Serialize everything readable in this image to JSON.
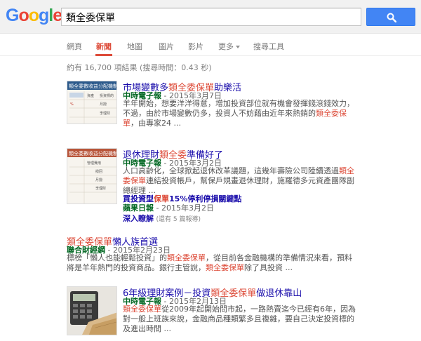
{
  "header": {
    "logo": "Google",
    "search_value": "類全委保單",
    "colors": {
      "search_button": "#4285f4",
      "accent": "#dd4b39",
      "link": "#1a0dab",
      "source": "#006621"
    }
  },
  "tabs": [
    {
      "label": "網頁"
    },
    {
      "label": "新聞"
    },
    {
      "label": "地圖"
    },
    {
      "label": "圖片"
    },
    {
      "label": "影片"
    },
    {
      "label": "更多"
    },
    {
      "label": "搜尋工具"
    }
  ],
  "stats": "約有 16,700 項結果 (搜尋時間：0.43 秒)",
  "results": [
    {
      "title_pre": "市場變數多",
      "title_hl": "類全委保單",
      "title_post": "助樂活",
      "source": "中時電子報",
      "date": " - 2015年3月7日",
      "snippet_a": "羊年開始，想要洋洋得意，增加投資部位就有機會發揮錢滾錢效力，不過，由於市場變數仍多，投資人不妨藉由近年來熱銷的",
      "snippet_hl": "類全委保單",
      "snippet_b": "，由專家24 ...",
      "thumb_title": "類全委數收益分配機制",
      "thumb_rows": [
        "資產",
        "投資標的",
        "月撥",
        "李理財"
      ]
    },
    {
      "title_pre": "退休理財",
      "title_hl": "類全委",
      "title_post": "準備好了",
      "source": "中時電子報",
      "date": " - 2015年3月2日",
      "snippet_a": "人口高齡化，全球掀起退休改革議題，這幾年壽險公司陸續透過",
      "snippet_hl": "類全委保單",
      "snippet_b": "連結投資帳戶，幫保戶規畫退休理財，施羅德多元資產團隊副總經理 ...",
      "thumb_title": "類全委數收益分配機制",
      "thumb_rows": [
        "管理費用",
        "撥回",
        "月撥",
        "李理財"
      ],
      "sub_pre": "買投資型",
      "sub_hl": "保單",
      "sub_post": "15%停利停損關鍵點",
      "sub_source": "蘋果日報",
      "sub_date": " - 2015年3月2日",
      "more_link": "深入瞭解",
      "more_count": "(還有 5 篇報導)"
    },
    {
      "title_hl": "類全委保單",
      "title_post": "懶人族首選",
      "source": "聯合財經網",
      "date": " - 2015年2月23日",
      "snippet_a": "標榜「懶人也能輕鬆投資」的",
      "snippet_hl": "類全委保單",
      "snippet_b": "，從目前各金融機構的準備情況來看，預料將是羊年熱門的投資商品。銀行主管說，",
      "snippet_hl2": "類全委保單",
      "snippet_c": "除了具投資 ..."
    },
    {
      "title_pre": "6年級理財案例－投資",
      "title_hl": "類全委保單",
      "title_post": "做退休靠山",
      "source": "中時電子報",
      "date": " - 2015年2月13日",
      "snippet_hl": "類全委保單",
      "snippet_a": "從2009年起開始問市起，一路熱賣迄今已經有6年，因為對一般上班族來說，金融商品種類繁多且複雜，要自己決定投資標的及進出時間 ..."
    }
  ]
}
